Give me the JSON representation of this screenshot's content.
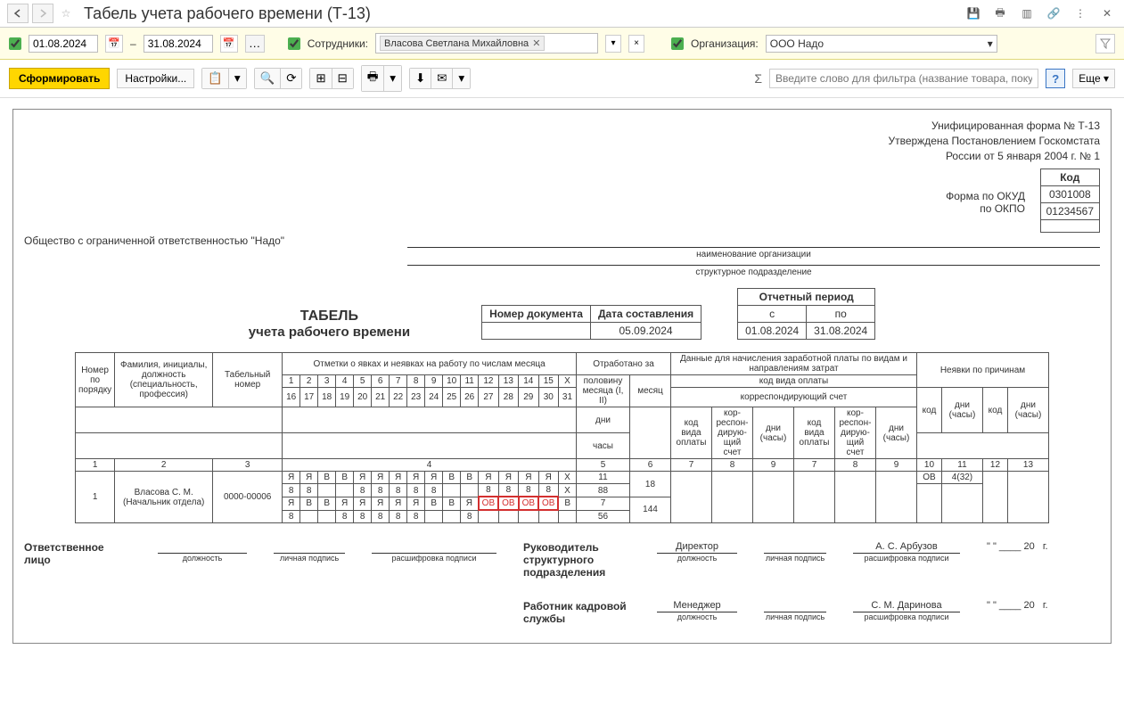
{
  "header": {
    "title": "Табель учета рабочего времени (Т-13)"
  },
  "filters": {
    "date_from": "01.08.2024",
    "date_to": "31.08.2024",
    "dash": "–",
    "employees_label": "Сотрудники:",
    "employee_chip": "Власова Светлана Михайловна",
    "org_label": "Организация:",
    "org_value": "ООО Надо"
  },
  "toolbar": {
    "generate": "Сформировать",
    "settings": "Настройки...",
    "search_placeholder": "Введите слово для фильтра (название товара, покупателя …",
    "more": "Еще"
  },
  "doc": {
    "form_line1": "Унифицированная форма № Т-13",
    "form_line2": "Утверждена Постановлением Госкомстата",
    "form_line3": "России от 5 января 2004 г. № 1",
    "code_header": "Код",
    "okud_label": "Форма по ОКУД",
    "okud": "0301008",
    "okpo_label": "по ОКПО",
    "okpo": "01234567",
    "org_full": "Общество с ограниченной ответственностью \"Надо\"",
    "org_caption": "наименование организации",
    "dept_caption": "структурное подразделение",
    "docnum_h": "Номер документа",
    "docdate_h": "Дата составления",
    "docdate": "05.09.2024",
    "period_h": "Отчетный период",
    "period_from_h": "с",
    "period_to_h": "по",
    "period_from": "01.08.2024",
    "period_to": "31.08.2024",
    "title": "ТАБЕЛЬ",
    "subtitle": "учета  рабочего времени",
    "h_num": "Номер по порядку",
    "h_name": "Фамилия, инициалы, должность (специальность, профессия)",
    "h_tab": "Табельный номер",
    "h_marks": "Отметки о явках и неявках на работу по числам месяца",
    "h_worked": "Отработано за",
    "h_half": "половину месяца (I, II)",
    "h_month": "месяц",
    "h_days": "дни",
    "h_hours": "часы",
    "h_calc": "Данные для начисления заработной платы по видам и направлениям затрат",
    "h_paycode": "код вида оплаты",
    "h_corr": "корреспондирующий счет",
    "h_paycode_s": "код вида оплаты",
    "h_corr_s": "кор-респон-дирую-щий счет",
    "h_dayshours": "дни (часы)",
    "h_abs": "Неявки по причинам",
    "h_code": "код",
    "row": {
      "num": "1",
      "name": "Власова С. М. (Начальник отдела)",
      "tabnum": "0000-00006",
      "r1": [
        "Я",
        "Я",
        "В",
        "В",
        "Я",
        "Я",
        "Я",
        "Я",
        "Я",
        "В",
        "В",
        "Я",
        "Я",
        "Я",
        "Я",
        "Х"
      ],
      "r2": [
        "8",
        "8",
        "",
        "",
        "8",
        "8",
        "8",
        "8",
        "8",
        "",
        "",
        "8",
        "8",
        "8",
        "8",
        "Х"
      ],
      "r3": [
        "Я",
        "В",
        "В",
        "Я",
        "Я",
        "Я",
        "Я",
        "Я",
        "В",
        "В",
        "Я",
        "ОВ",
        "ОВ",
        "ОВ",
        "ОВ",
        "В"
      ],
      "r4": [
        "8",
        "",
        "",
        "8",
        "8",
        "8",
        "8",
        "8",
        "",
        "",
        "8",
        "",
        "",
        "",
        "",
        ""
      ],
      "half1_d": "11",
      "half1_h": "88",
      "half2_d": "7",
      "half2_h": "56",
      "month_d": "18",
      "month_h": "144",
      "abs_code": "ОВ",
      "abs_val": "4(32)"
    },
    "cn": [
      "1",
      "2",
      "3",
      "4",
      "5",
      "6",
      "7",
      "8",
      "9",
      "10",
      "11",
      "12",
      "13"
    ],
    "days1": [
      "1",
      "2",
      "3",
      "4",
      "5",
      "6",
      "7",
      "8",
      "9",
      "10",
      "11",
      "12",
      "13",
      "14",
      "15",
      "Х"
    ],
    "days2": [
      "16",
      "17",
      "18",
      "19",
      "20",
      "21",
      "22",
      "23",
      "24",
      "25",
      "26",
      "27",
      "28",
      "29",
      "30",
      "31"
    ],
    "sig": {
      "resp": "Ответственное лицо",
      "pos": "должность",
      "sign": "личная подпись",
      "decode": "расшифровка подписи",
      "head": "Руководитель структурного подразделения",
      "head_pos": "Директор",
      "head_name": "А. С. Арбузов",
      "hr": "Работник кадровой службы",
      "hr_pos": "Менеджер",
      "hr_name": "С. М. Даринова",
      "year": "20",
      "g": "г.",
      "q": "\" \""
    }
  }
}
